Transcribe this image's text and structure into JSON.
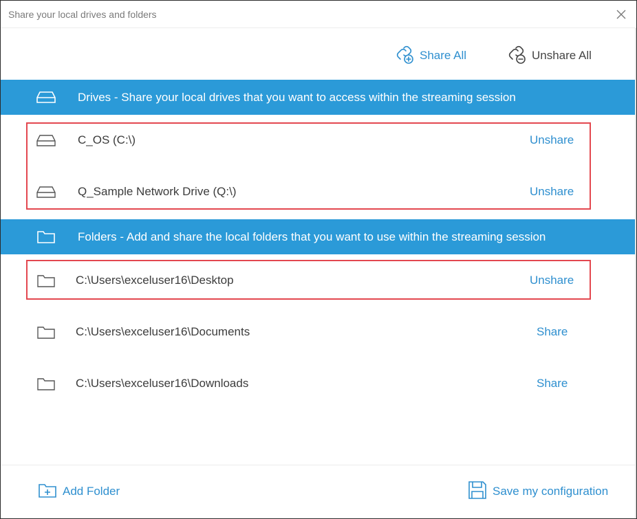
{
  "window": {
    "title": "Share your local drives and folders"
  },
  "toolbar": {
    "share_all_label": "Share All",
    "unshare_all_label": "Unshare All"
  },
  "drives": {
    "header": "Drives - Share your local drives that you want to access within the streaming session",
    "items": [
      {
        "name": "C_OS (C:\\)",
        "action": "Unshare"
      },
      {
        "name": "Q_Sample Network Drive (Q:\\)",
        "action": "Unshare"
      }
    ]
  },
  "folders": {
    "header": "Folders - Add and share the local folders that you want to use within the streaming session",
    "items": [
      {
        "path": "C:\\Users\\exceluser16\\Desktop",
        "action": "Unshare"
      },
      {
        "path": "C:\\Users\\exceluser16\\Documents",
        "action": "Share"
      },
      {
        "path": "C:\\Users\\exceluser16\\Downloads",
        "action": "Share"
      }
    ]
  },
  "footer": {
    "add_folder_label": "Add Folder",
    "save_label": "Save my configuration"
  },
  "icons": {
    "share_all": "link-add-icon",
    "unshare_all": "link-remove-icon",
    "drive": "hard-drive-icon",
    "folder": "folder-icon",
    "add_folder": "folder-add-icon",
    "save": "floppy-disk-icon",
    "close": "close-icon"
  },
  "colors": {
    "accent": "#2b9ad8",
    "link": "#2e8fcf",
    "highlight": "#e3474f"
  }
}
